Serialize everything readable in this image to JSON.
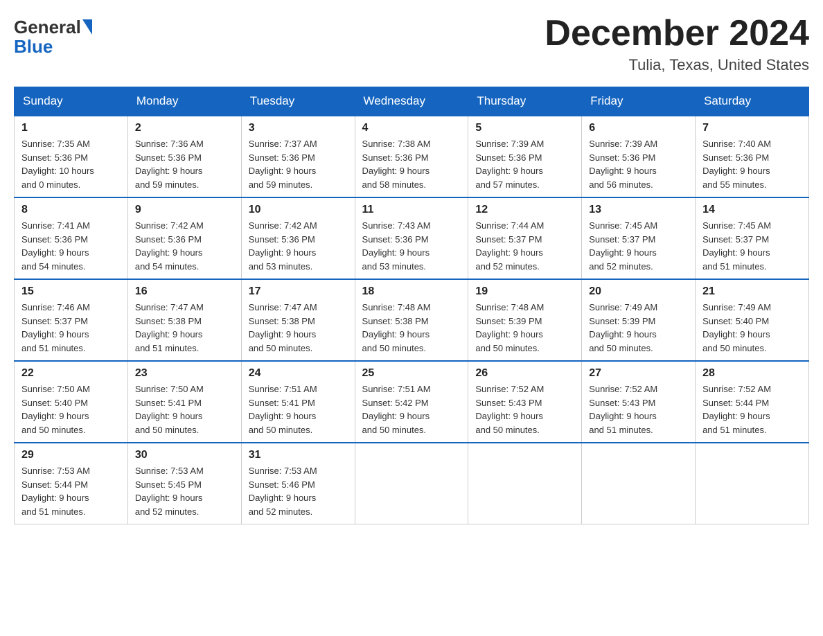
{
  "logo": {
    "general": "General",
    "blue": "Blue"
  },
  "header": {
    "month": "December 2024",
    "location": "Tulia, Texas, United States"
  },
  "days_of_week": [
    "Sunday",
    "Monday",
    "Tuesday",
    "Wednesday",
    "Thursday",
    "Friday",
    "Saturday"
  ],
  "weeks": [
    [
      {
        "day": "1",
        "sunrise": "7:35 AM",
        "sunset": "5:36 PM",
        "daylight": "10 hours and 0 minutes."
      },
      {
        "day": "2",
        "sunrise": "7:36 AM",
        "sunset": "5:36 PM",
        "daylight": "9 hours and 59 minutes."
      },
      {
        "day": "3",
        "sunrise": "7:37 AM",
        "sunset": "5:36 PM",
        "daylight": "9 hours and 59 minutes."
      },
      {
        "day": "4",
        "sunrise": "7:38 AM",
        "sunset": "5:36 PM",
        "daylight": "9 hours and 58 minutes."
      },
      {
        "day": "5",
        "sunrise": "7:39 AM",
        "sunset": "5:36 PM",
        "daylight": "9 hours and 57 minutes."
      },
      {
        "day": "6",
        "sunrise": "7:39 AM",
        "sunset": "5:36 PM",
        "daylight": "9 hours and 56 minutes."
      },
      {
        "day": "7",
        "sunrise": "7:40 AM",
        "sunset": "5:36 PM",
        "daylight": "9 hours and 55 minutes."
      }
    ],
    [
      {
        "day": "8",
        "sunrise": "7:41 AM",
        "sunset": "5:36 PM",
        "daylight": "9 hours and 54 minutes."
      },
      {
        "day": "9",
        "sunrise": "7:42 AM",
        "sunset": "5:36 PM",
        "daylight": "9 hours and 54 minutes."
      },
      {
        "day": "10",
        "sunrise": "7:42 AM",
        "sunset": "5:36 PM",
        "daylight": "9 hours and 53 minutes."
      },
      {
        "day": "11",
        "sunrise": "7:43 AM",
        "sunset": "5:36 PM",
        "daylight": "9 hours and 53 minutes."
      },
      {
        "day": "12",
        "sunrise": "7:44 AM",
        "sunset": "5:37 PM",
        "daylight": "9 hours and 52 minutes."
      },
      {
        "day": "13",
        "sunrise": "7:45 AM",
        "sunset": "5:37 PM",
        "daylight": "9 hours and 52 minutes."
      },
      {
        "day": "14",
        "sunrise": "7:45 AM",
        "sunset": "5:37 PM",
        "daylight": "9 hours and 51 minutes."
      }
    ],
    [
      {
        "day": "15",
        "sunrise": "7:46 AM",
        "sunset": "5:37 PM",
        "daylight": "9 hours and 51 minutes."
      },
      {
        "day": "16",
        "sunrise": "7:47 AM",
        "sunset": "5:38 PM",
        "daylight": "9 hours and 51 minutes."
      },
      {
        "day": "17",
        "sunrise": "7:47 AM",
        "sunset": "5:38 PM",
        "daylight": "9 hours and 50 minutes."
      },
      {
        "day": "18",
        "sunrise": "7:48 AM",
        "sunset": "5:38 PM",
        "daylight": "9 hours and 50 minutes."
      },
      {
        "day": "19",
        "sunrise": "7:48 AM",
        "sunset": "5:39 PM",
        "daylight": "9 hours and 50 minutes."
      },
      {
        "day": "20",
        "sunrise": "7:49 AM",
        "sunset": "5:39 PM",
        "daylight": "9 hours and 50 minutes."
      },
      {
        "day": "21",
        "sunrise": "7:49 AM",
        "sunset": "5:40 PM",
        "daylight": "9 hours and 50 minutes."
      }
    ],
    [
      {
        "day": "22",
        "sunrise": "7:50 AM",
        "sunset": "5:40 PM",
        "daylight": "9 hours and 50 minutes."
      },
      {
        "day": "23",
        "sunrise": "7:50 AM",
        "sunset": "5:41 PM",
        "daylight": "9 hours and 50 minutes."
      },
      {
        "day": "24",
        "sunrise": "7:51 AM",
        "sunset": "5:41 PM",
        "daylight": "9 hours and 50 minutes."
      },
      {
        "day": "25",
        "sunrise": "7:51 AM",
        "sunset": "5:42 PM",
        "daylight": "9 hours and 50 minutes."
      },
      {
        "day": "26",
        "sunrise": "7:52 AM",
        "sunset": "5:43 PM",
        "daylight": "9 hours and 50 minutes."
      },
      {
        "day": "27",
        "sunrise": "7:52 AM",
        "sunset": "5:43 PM",
        "daylight": "9 hours and 51 minutes."
      },
      {
        "day": "28",
        "sunrise": "7:52 AM",
        "sunset": "5:44 PM",
        "daylight": "9 hours and 51 minutes."
      }
    ],
    [
      {
        "day": "29",
        "sunrise": "7:53 AM",
        "sunset": "5:44 PM",
        "daylight": "9 hours and 51 minutes."
      },
      {
        "day": "30",
        "sunrise": "7:53 AM",
        "sunset": "5:45 PM",
        "daylight": "9 hours and 52 minutes."
      },
      {
        "day": "31",
        "sunrise": "7:53 AM",
        "sunset": "5:46 PM",
        "daylight": "9 hours and 52 minutes."
      },
      null,
      null,
      null,
      null
    ]
  ],
  "labels": {
    "sunrise": "Sunrise:",
    "sunset": "Sunset:",
    "daylight": "Daylight:"
  }
}
